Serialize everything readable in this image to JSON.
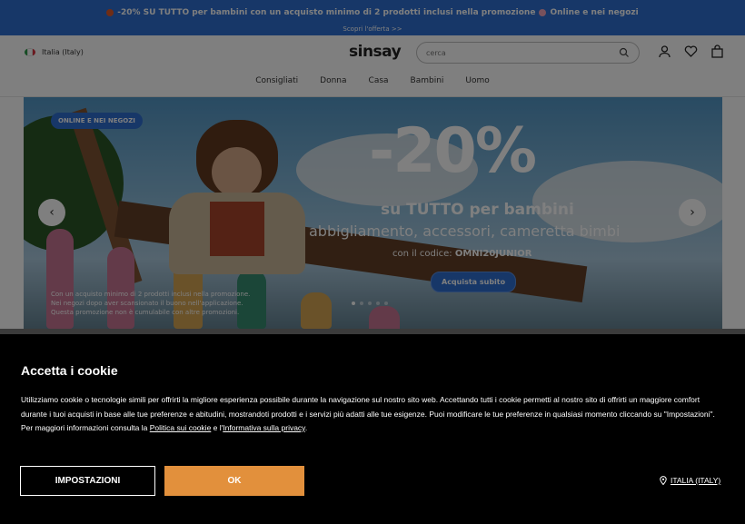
{
  "promo": {
    "text": "-20% SU TUTTO per bambini con un acquisto minimo di 2 prodotti inclusi nella promozione",
    "suffix": "Online e nei negozi",
    "link": "Scopri l'offerta >>"
  },
  "header": {
    "country": "Italia (Italy)",
    "logo": "sinsay",
    "search_placeholder": "cerca",
    "nav": [
      "Consigliati",
      "Donna",
      "Casa",
      "Bambini",
      "Uomo"
    ]
  },
  "banner": {
    "badge": "ONLINE E NEI NEGOZI",
    "discount": "-20%",
    "headline": "su TUTTO per bambini",
    "subline": "abbigliamento, accessori, cameretta bimbi",
    "code_prefix": "con il codice:",
    "code": "OMNI20JUNIOR",
    "cta": "Acquista subito",
    "fine_print": [
      "Con un acquisto minimo di 2 prodotti inclusi nella promozione.",
      "Nei negozi dopo aver scansionato il buono nell'applicazione.",
      "Questa promozione non è cumulabile con altre promozioni."
    ],
    "slides_total": 5,
    "slide_active": 1
  },
  "cookie": {
    "title": "Accetta i cookie",
    "body_1": "Utilizziamo cookie o tecnologie simili per offrirti la migliore esperienza possibile durante la navigazione sul nostro sito web. Accettando tutti i cookie permetti al nostro sito di offrirti un maggiore comfort durante i tuoi acquisti in base alle tue preferenze e abitudini, mostrandoti prodotti e i servizi più adatti alle tue esigenze. Puoi modificare le tue preferenze in qualsiasi momento cliccando su \"Impostazioni\". Per maggiori informazioni consulta la ",
    "link_1": "Politica sui cookie",
    "between": " e l'",
    "link_2": "Informativa sulla privacy",
    "end": ".",
    "settings_label": "IMPOSTAZIONI",
    "ok_label": "OK",
    "locale": "ITALIA (ITALY)"
  },
  "colors": {
    "brand_blue": "#2f6fd0",
    "ok_orange": "#e2903c"
  }
}
